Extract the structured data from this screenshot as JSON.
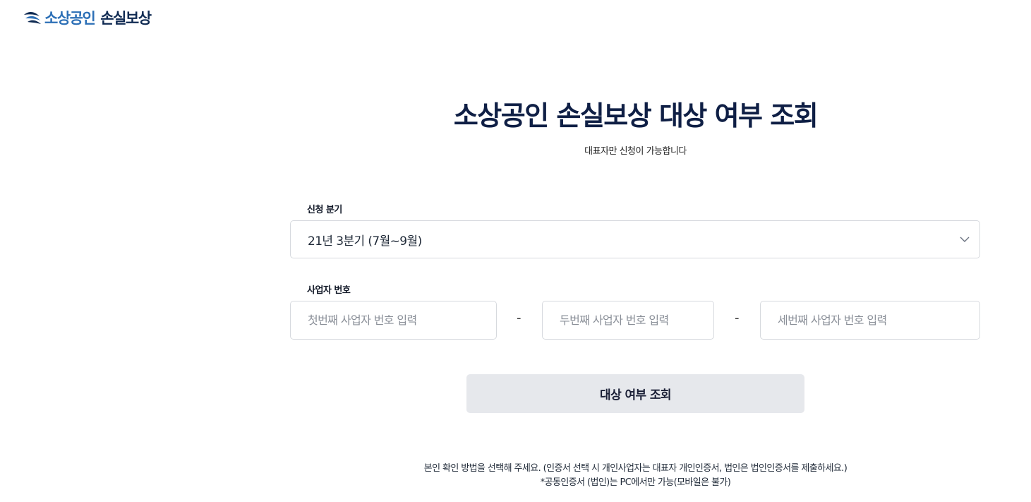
{
  "header": {
    "logo_part1": "소상공인",
    "logo_part2": "손실보상"
  },
  "main": {
    "title": "소상공인 손실보상 대상 여부 조회",
    "subtitle": "대표자만 신청이 가능합니다"
  },
  "form": {
    "quarter_label": "신청 분기",
    "quarter_selected": "21년 3분기 (7월~9월)",
    "bizno_label": "사업자 번호",
    "bizno_first_placeholder": "첫번째 사업자 번호 입력",
    "bizno_second_placeholder": "두번째 사업자 번호 입력",
    "bizno_third_placeholder": "세번째 사업자 번호 입력",
    "separator": "-",
    "submit_label": "대상 여부 조회"
  },
  "notes": {
    "line1": "본인 확인 방법을 선택해 주세요. (인증서 선택 시 개인사업자는 대표자 개인인증서, 법인은 법인인증서를 제출하세요.)",
    "line2": "*공동인증서 (법인)는 PC에서만 가능(모바일은 불가)"
  },
  "colors": {
    "logo_blue": "#2c6fb6",
    "logo_navy": "#0f2a52",
    "title": "#0f1f45",
    "button_bg": "#e6e8ec",
    "border": "#d6d9de"
  },
  "icons": {
    "logo": "wing-logo-icon",
    "select_arrow": "chevron-down-icon"
  }
}
